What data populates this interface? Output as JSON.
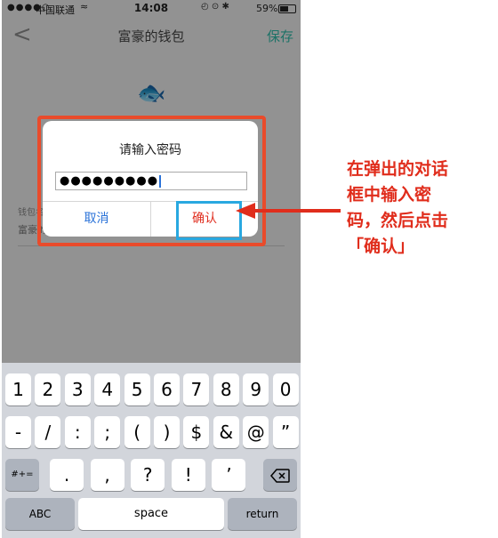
{
  "status_bar": {
    "carrier": "中国联通",
    "time": "14:08",
    "battery_percent": "59%",
    "battery_level": 0.59
  },
  "nav": {
    "title": "富豪的钱包",
    "save_label": "保存"
  },
  "form": {
    "field_label": "钱包名",
    "field_value": "富豪的"
  },
  "dialog": {
    "title": "请输入密码",
    "password_mask": "●●●●●●●●●",
    "cancel_label": "取消",
    "confirm_label": "确认"
  },
  "keyboard": {
    "row1": [
      "1",
      "2",
      "3",
      "4",
      "5",
      "6",
      "7",
      "8",
      "9",
      "0"
    ],
    "row2": [
      "-",
      "/",
      ":",
      ";",
      "(",
      ")",
      "$",
      "&",
      "@",
      "”"
    ],
    "row3_left": "#+=",
    "row3": [
      ".",
      ",",
      "?",
      "!",
      "’"
    ],
    "abc_label": "ABC",
    "space_label": "space",
    "return_label": "return"
  },
  "annotation": {
    "text_lines": [
      "在弹出的对话",
      "框中输入密",
      "码，然后点击",
      "「确认」"
    ],
    "highlight_color": "#e94b2b",
    "focus_color": "#29a8e0"
  }
}
